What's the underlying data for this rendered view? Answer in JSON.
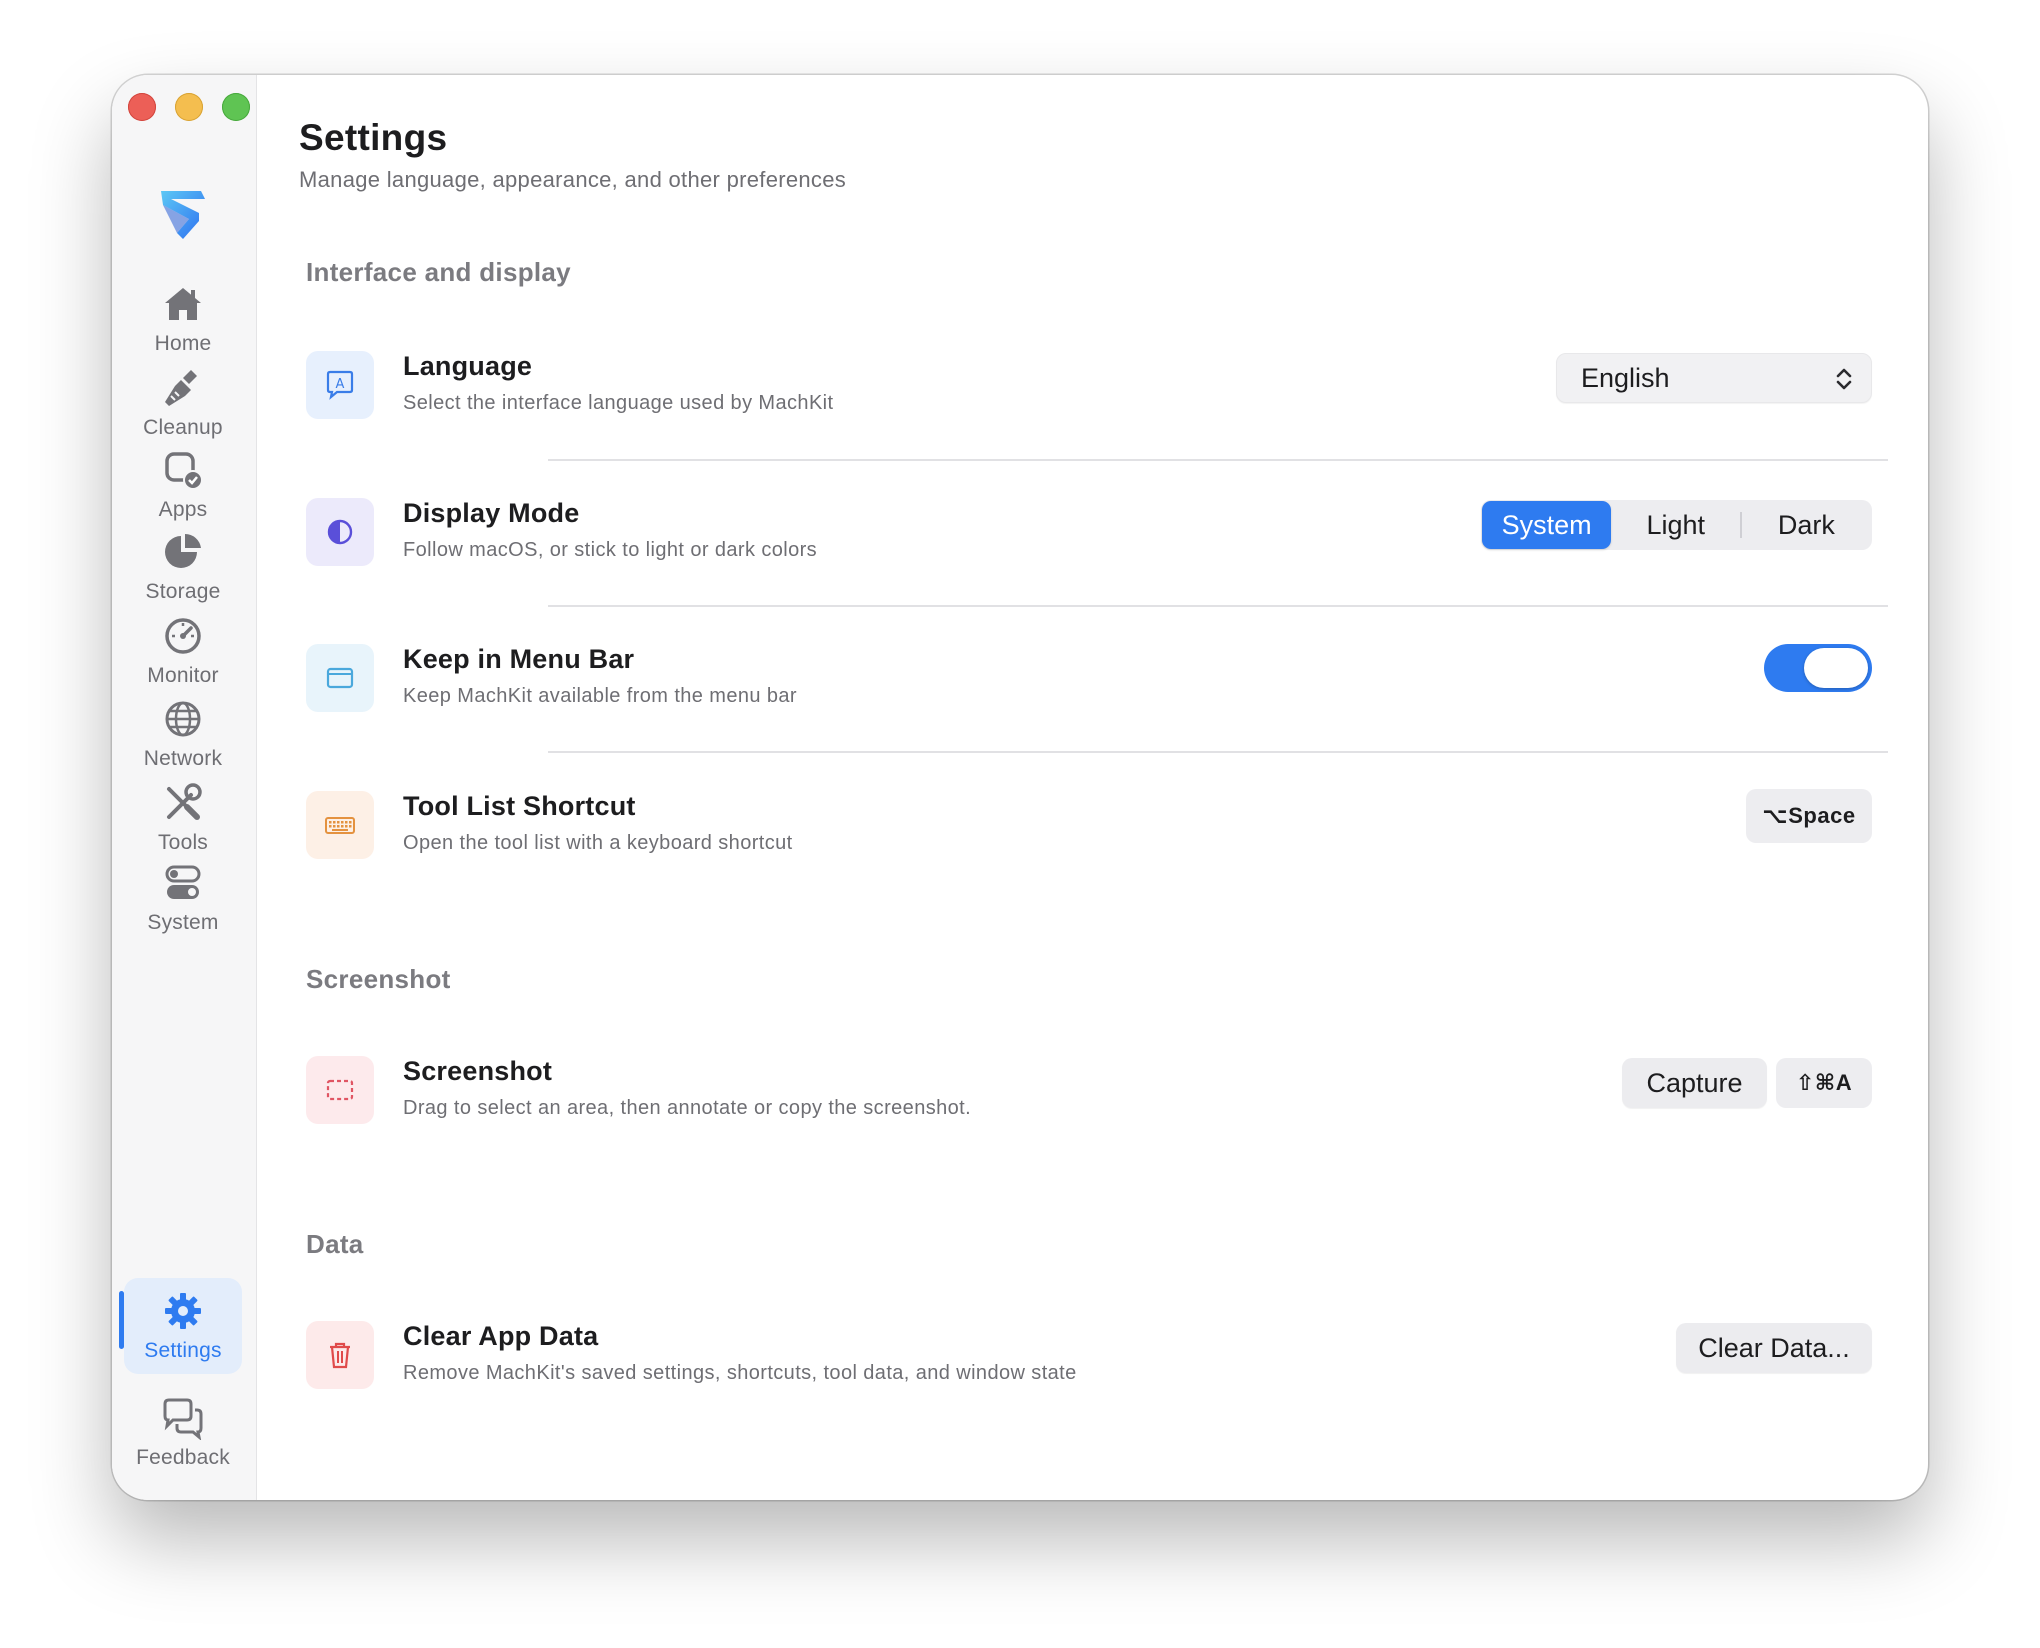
{
  "window": {
    "traffic_lights": [
      "close",
      "minimize",
      "zoom"
    ]
  },
  "sidebar": {
    "items": [
      {
        "label": "Home",
        "icon": "house-icon"
      },
      {
        "label": "Cleanup",
        "icon": "broom-icon"
      },
      {
        "label": "Apps",
        "icon": "app-check-icon"
      },
      {
        "label": "Storage",
        "icon": "pie-chart-icon"
      },
      {
        "label": "Monitor",
        "icon": "gauge-icon"
      },
      {
        "label": "Network",
        "icon": "globe-icon"
      },
      {
        "label": "Tools",
        "icon": "wrench-screwdriver-icon"
      },
      {
        "label": "System",
        "icon": "toggles-icon"
      },
      {
        "label": "Settings",
        "icon": "gear-icon",
        "active": true
      },
      {
        "label": "Feedback",
        "icon": "chat-bubbles-icon"
      }
    ],
    "accent_color": "#2e7bf0"
  },
  "page": {
    "title": "Settings",
    "subtitle": "Manage language, appearance, and other preferences"
  },
  "sections": {
    "interface": {
      "title": "Interface and display",
      "language": {
        "title": "Language",
        "desc": "Select the interface language used by MachKit",
        "value": "English",
        "icon": "language-bubble-icon",
        "icon_bg": "#e7f0fd"
      },
      "display_mode": {
        "title": "Display Mode",
        "desc": "Follow macOS, or stick to light or dark colors",
        "options": [
          "System",
          "Light",
          "Dark"
        ],
        "selected": "System",
        "icon": "half-circle-icon",
        "icon_bg": "#eceafb"
      },
      "menu_bar": {
        "title": "Keep in Menu Bar",
        "desc": "Keep MachKit available from the menu bar",
        "enabled": true,
        "icon": "window-icon",
        "icon_bg": "#e8f4fb"
      },
      "shortcut": {
        "title": "Tool List Shortcut",
        "desc": "Open the tool list with a keyboard shortcut",
        "value": "⌥Space",
        "icon": "keyboard-icon",
        "icon_bg": "#fdf0e6"
      }
    },
    "screenshot": {
      "title": "Screenshot",
      "item": {
        "title": "Screenshot",
        "desc": "Drag to select an area, then annotate or copy the screenshot.",
        "capture_label": "Capture",
        "shortcut": "⇧⌘A",
        "icon": "dashed-selection-icon",
        "icon_bg": "#fdeaec"
      }
    },
    "data": {
      "title": "Data",
      "clear": {
        "title": "Clear App Data",
        "desc": "Remove MachKit's saved settings, shortcuts, tool data, and window state",
        "button_label": "Clear Data...",
        "icon": "trash-icon",
        "icon_bg": "#fdeaea"
      }
    }
  }
}
